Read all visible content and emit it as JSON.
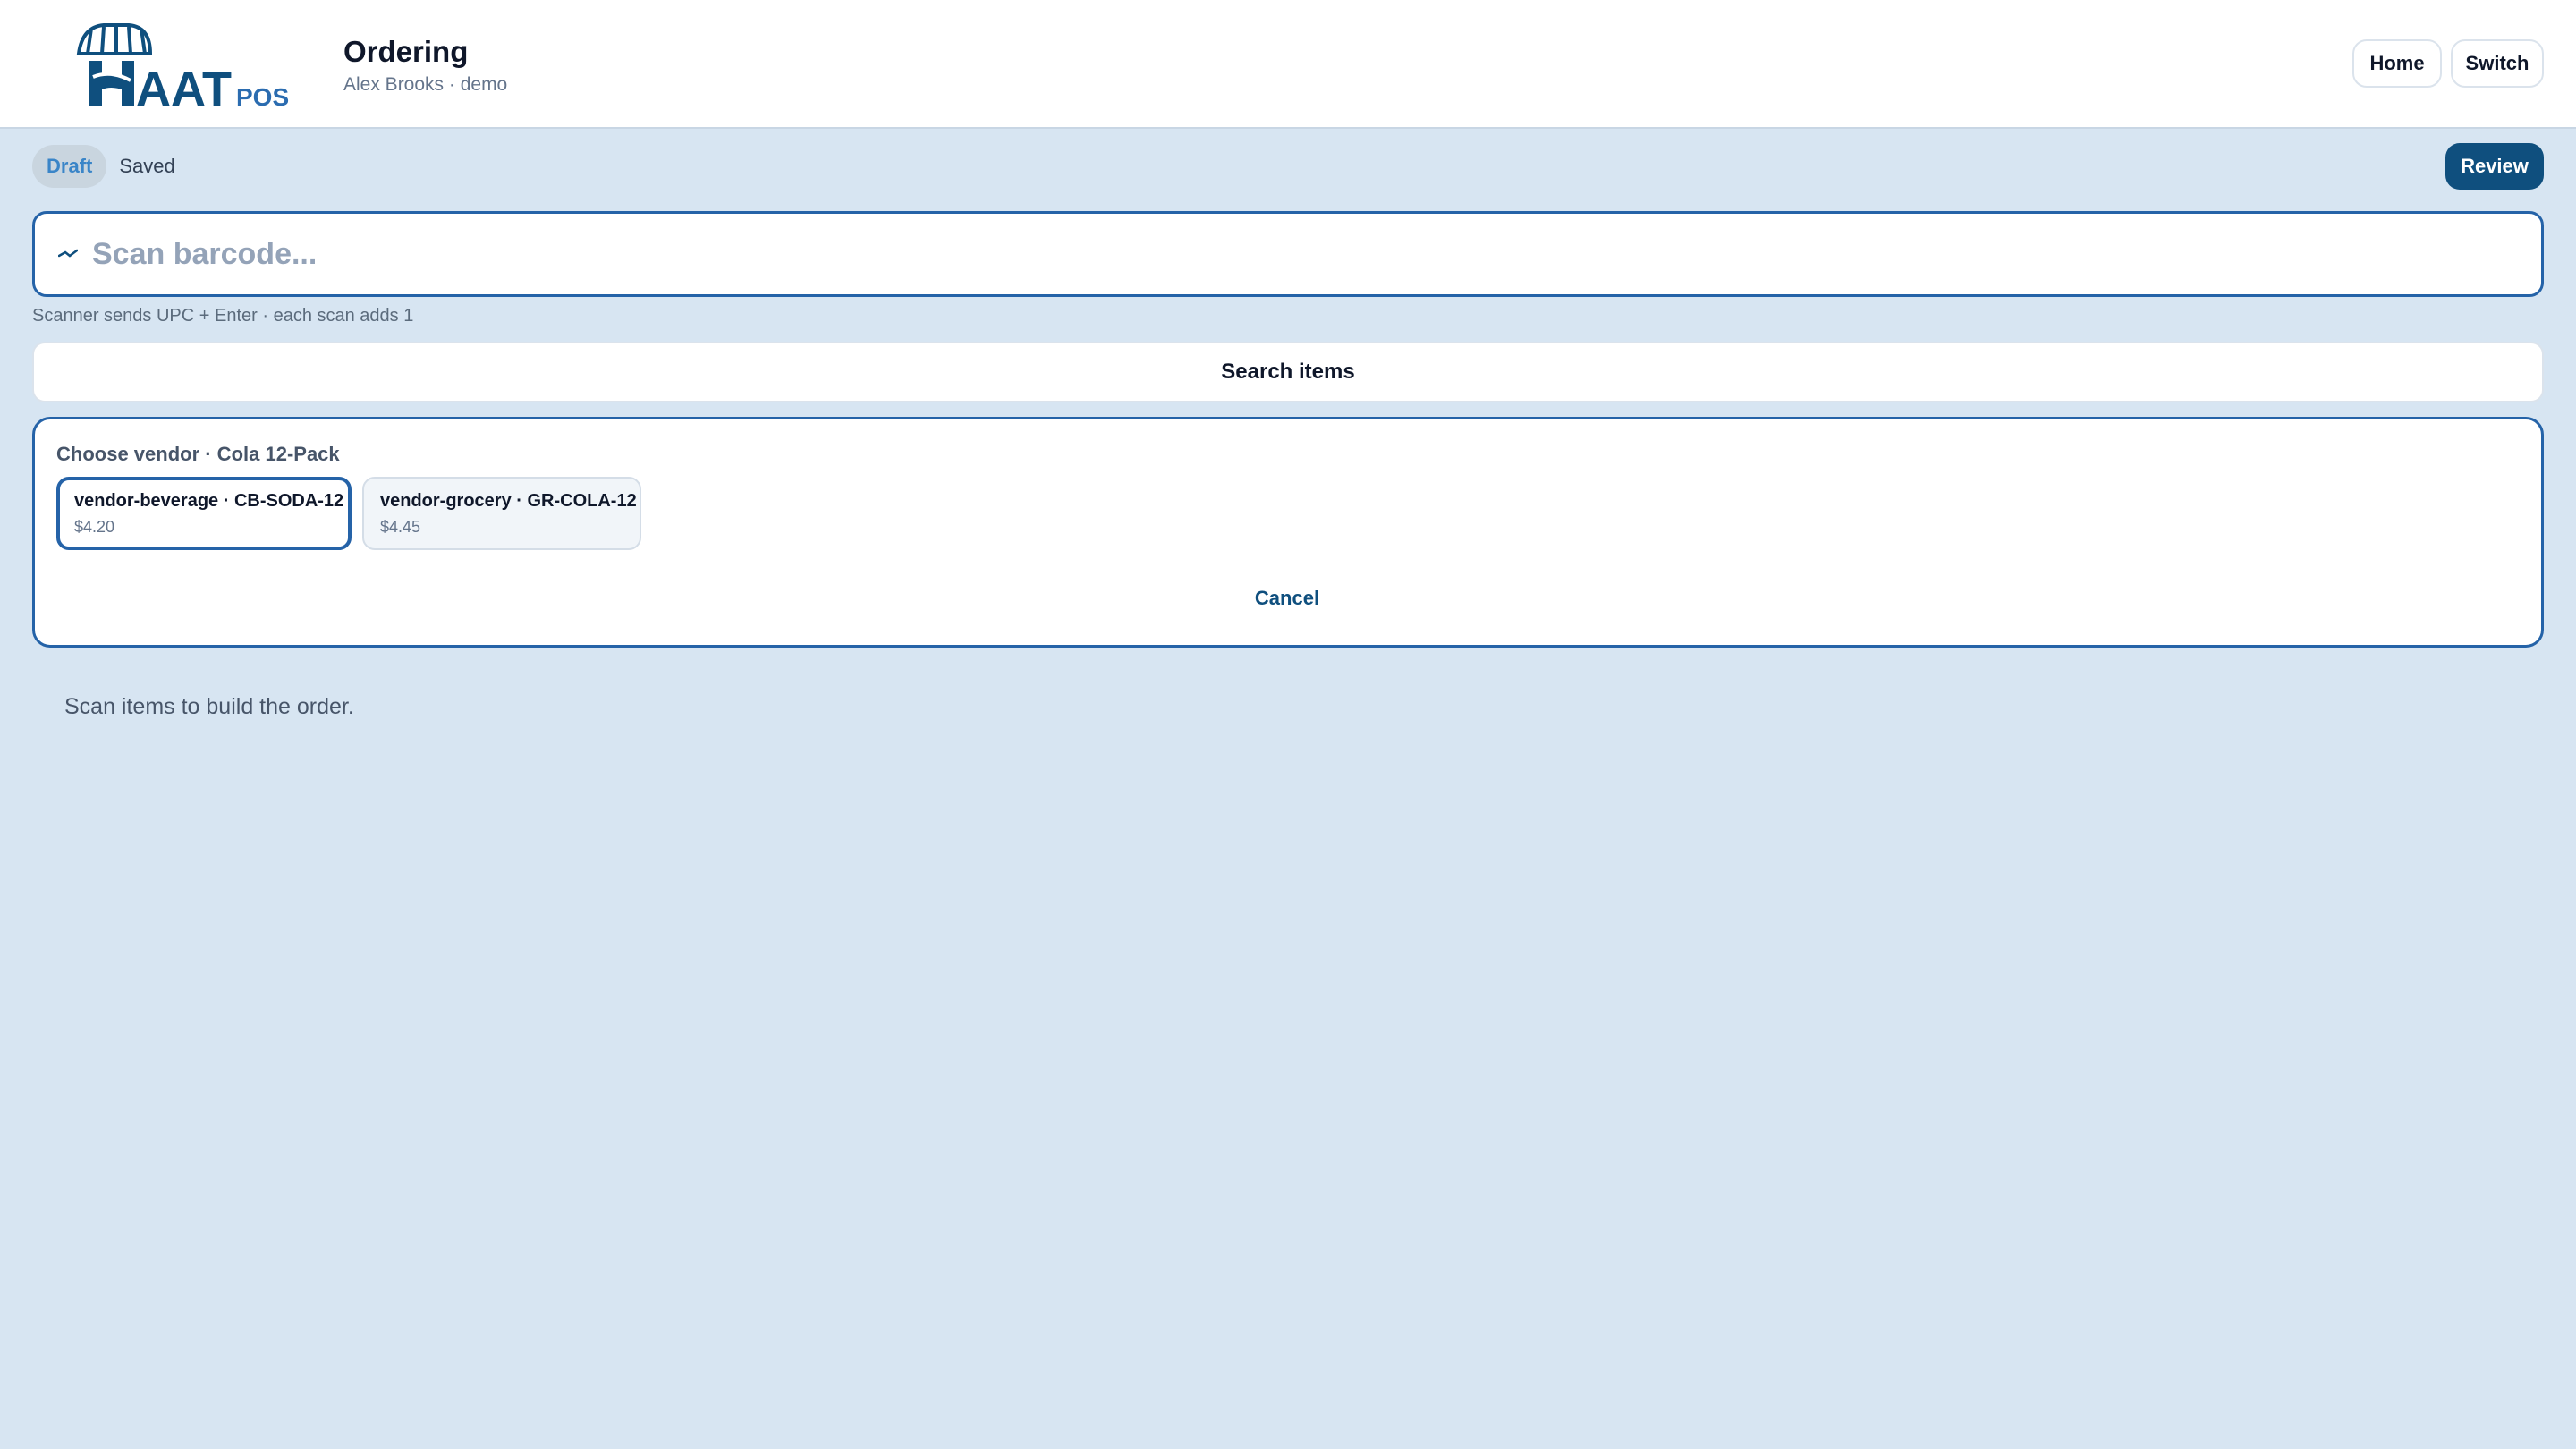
{
  "header": {
    "logo_text": "HAAT POS",
    "title": "Ordering",
    "subtitle": "Alex Brooks · demo",
    "home_label": "Home",
    "switch_label": "Switch"
  },
  "status": {
    "draft_label": "Draft",
    "saved_label": "Saved",
    "review_label": "Review"
  },
  "scan": {
    "icon": "barcode-scan-icon",
    "placeholder": "Scan barcode...",
    "hint": "Scanner sends UPC + Enter · each scan adds 1"
  },
  "search": {
    "label": "Search items"
  },
  "vendor_picker": {
    "title": "Choose vendor · Cola 12-Pack",
    "options": [
      {
        "label": "vendor-beverage · CB-SODA-12",
        "price": "$4.20",
        "selected": true
      },
      {
        "label": "vendor-grocery · GR-COLA-12",
        "price": "$4.45",
        "selected": false
      }
    ],
    "cancel_label": "Cancel"
  },
  "order": {
    "empty_message": "Scan items to build the order."
  },
  "colors": {
    "background": "#d7e5f2",
    "accent": "#0f4f7e",
    "focus_border": "#2563a8",
    "draft_text": "#3a85c8"
  }
}
